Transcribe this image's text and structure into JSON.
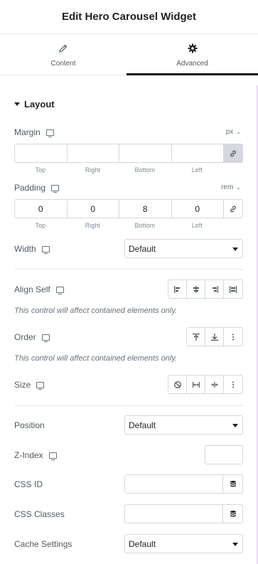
{
  "header": {
    "title": "Edit Hero Carousel Widget"
  },
  "tabs": [
    {
      "label": "Content",
      "icon": "pencil-icon"
    },
    {
      "label": "Advanced",
      "icon": "gear-icon"
    }
  ],
  "layout": {
    "section_title": "Layout",
    "margin": {
      "label": "Margin",
      "unit": "px",
      "values": [
        "",
        "",
        "",
        ""
      ],
      "sides": [
        "Top",
        "Right",
        "Bottom",
        "Left"
      ]
    },
    "padding": {
      "label": "Padding",
      "unit": "rem",
      "values": [
        "0",
        "0",
        "8",
        "0"
      ],
      "sides": [
        "Top",
        "Right",
        "Bottom",
        "Left"
      ]
    },
    "width": {
      "label": "Width",
      "value": "Default"
    },
    "align_self": {
      "label": "Align Self",
      "note": "This control will affect contained elements only."
    },
    "order": {
      "label": "Order",
      "note": "This control will affect contained elements only."
    },
    "size": {
      "label": "Size"
    },
    "position": {
      "label": "Position",
      "value": "Default"
    },
    "z_index": {
      "label": "Z-Index",
      "value": ""
    },
    "css_id": {
      "label": "CSS ID",
      "value": ""
    },
    "css_classes": {
      "label": "CSS Classes",
      "value": ""
    },
    "cache_settings": {
      "label": "Cache Settings",
      "value": "Default"
    }
  }
}
